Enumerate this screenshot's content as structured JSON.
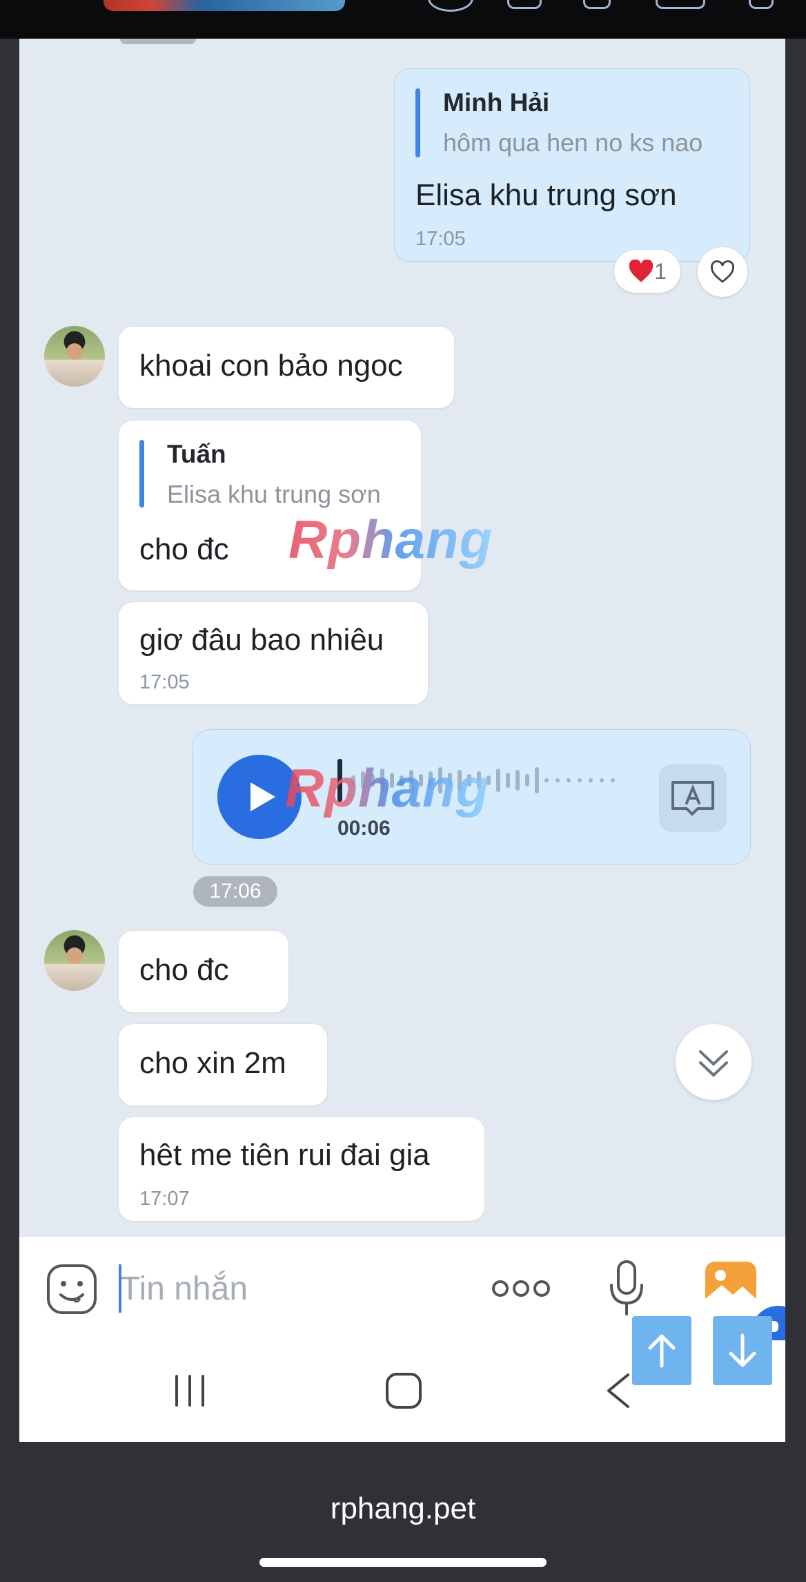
{
  "messages": [
    {
      "id": "m1",
      "side": "me",
      "quote": {
        "name": "Minh Hải",
        "text": "hôm qua hen no ks nao"
      },
      "text": "Elisa khu trung sơn",
      "time": "17:05",
      "reaction": {
        "emoji": "❤️",
        "count": "1"
      }
    },
    {
      "id": "m2",
      "side": "other",
      "text": "khoai con bảo ngoc"
    },
    {
      "id": "m3",
      "side": "other",
      "quote": {
        "name": "Tuấn",
        "text": "Elisa khu trung sơn"
      },
      "text": "cho đc"
    },
    {
      "id": "m4",
      "side": "other",
      "text": "giơ đâu bao nhiêu",
      "time": "17:05"
    },
    {
      "id": "m5",
      "side": "me",
      "type": "voice",
      "duration": "00:06"
    },
    {
      "id": "m6",
      "side": "other",
      "text": "cho đc"
    },
    {
      "id": "m7",
      "side": "other",
      "text": "cho xin 2m"
    },
    {
      "id": "m8",
      "side": "other",
      "text": "hêt me tiên rui đai gia",
      "time": "17:07"
    }
  ],
  "time_pill": "17:06",
  "watermark": "Rphang",
  "composer": {
    "placeholder": "Tin nhắn"
  },
  "footer": {
    "text": "rphang.pet"
  },
  "colors": {
    "accent": "#2a6de1",
    "chat_bg": "#e2e9f1",
    "my_bubble": "#d6ebfb"
  },
  "icons": [
    "emoji-icon",
    "more-icon",
    "microphone-icon",
    "gallery-icon",
    "play-icon",
    "transcribe-icon",
    "double-chevron-down-icon",
    "heart-icon",
    "recent-apps-icon",
    "home-icon",
    "back-icon",
    "arrow-up-icon",
    "arrow-down-icon"
  ]
}
